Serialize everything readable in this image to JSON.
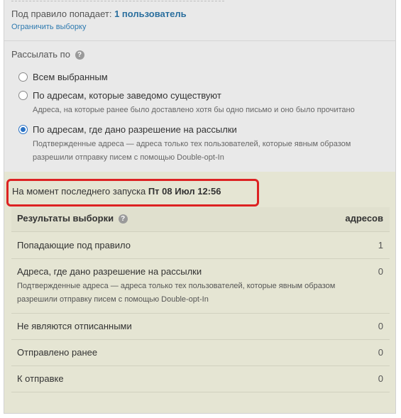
{
  "summary": {
    "prefix": "Под правило попадает:",
    "count": "1 пользователь",
    "limit_link": "Ограничить выборку"
  },
  "send_by": {
    "label": "Рассылать по",
    "help_icon": "?",
    "options": [
      {
        "label": "Всем выбранным",
        "checked": false
      },
      {
        "label": "По адресам, которые заведомо существуют",
        "checked": false,
        "description": "Адреса, на которые ранее было доставлено хотя бы одно письмо и оно было прочитано"
      },
      {
        "label": "По адресам, где дано разрешение на рассылки",
        "checked": true,
        "description": "Подтвержденные адреса — адреса только тех пользователей, которые явным образом разрешили отправку писем с помощью Double-opt-In"
      }
    ]
  },
  "last_run": {
    "prefix": "На момент последнего запуска",
    "date": "Пт 08 Июл 12:56"
  },
  "results": {
    "header_label": "Результаты выборки",
    "header_help_icon": "?",
    "header_value": "адресов",
    "rows": [
      {
        "label": "Попадающие под правило",
        "value": "1"
      },
      {
        "label": "Адреса, где дано разрешение на рассылки",
        "value": "0",
        "description": "Подтвержденные адреса — адреса только тех пользователей, которые явным образом разрешили отправку писем с помощью Double-opt-In"
      },
      {
        "label": "Не являются отписанными",
        "value": "0"
      },
      {
        "label": "Отправлено ранее",
        "value": "0"
      },
      {
        "label": "К отправке",
        "value": "0"
      }
    ]
  },
  "colors": {
    "accent": "#2b6f9e",
    "highlight_border": "#dd2222",
    "results_background": "#e5e5d3",
    "panel_background": "#e9e9e9"
  }
}
